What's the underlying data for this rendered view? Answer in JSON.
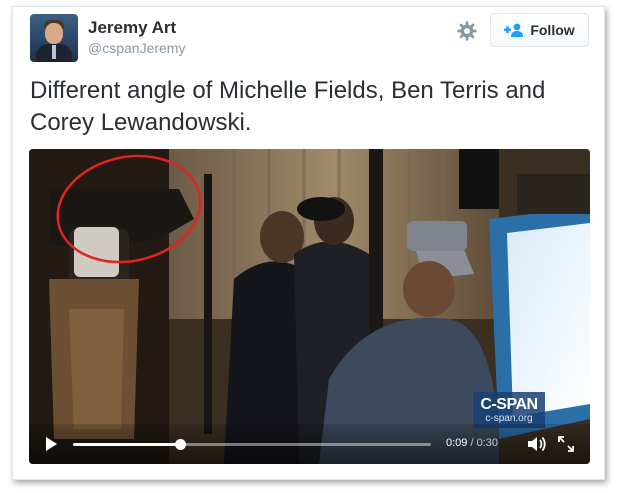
{
  "user": {
    "name": "Jeremy Art",
    "handle": "@cspanJeremy",
    "avatar_icon": "profile-photo"
  },
  "actions": {
    "settings_icon": "gear-icon",
    "follow_label": "Follow",
    "follow_icon": "add-user-icon"
  },
  "tweet": {
    "text": "Different angle of Michelle Fields, Ben Terris and Corey Lewandowski."
  },
  "video": {
    "watermark": {
      "logo": "C-SPAN",
      "site": "c-span.org"
    },
    "controls": {
      "current_time": "0:09",
      "separator": " / ",
      "duration": "0:30",
      "progress": 0.3
    },
    "colors": {
      "annotation_circle": "#e0241f",
      "watermark_bg": "#194173"
    }
  },
  "colors": {
    "text_primary": "#292f33",
    "text_secondary": "#8899a6",
    "follow_accent": "#1da1f2"
  }
}
